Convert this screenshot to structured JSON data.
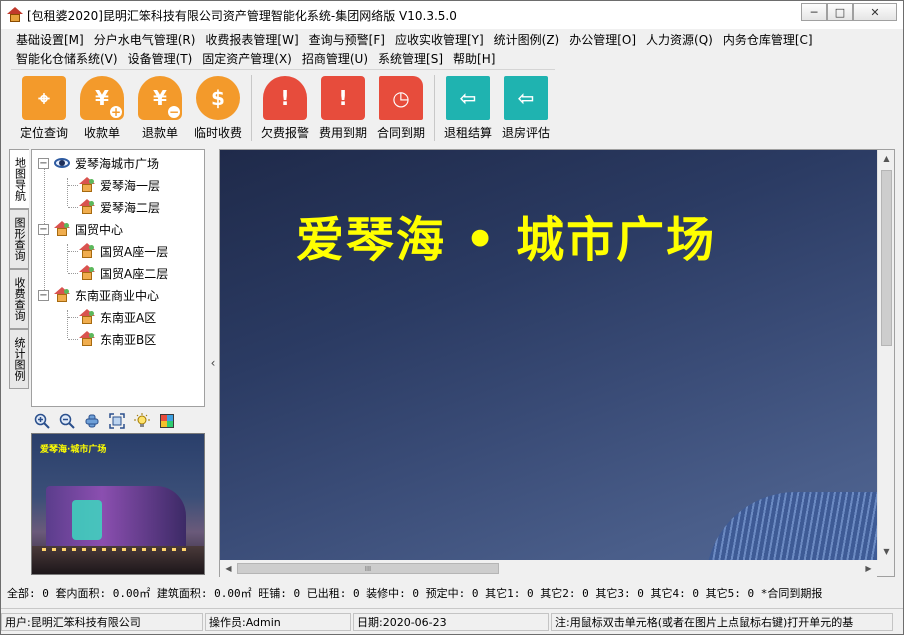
{
  "window": {
    "title": "[包租婆2020]昆明汇笨科技有限公司资产管理智能化系统-集团网络版 V10.3.5.0",
    "min_glyph": "─",
    "max_glyph": "□",
    "close_glyph": "✕"
  },
  "menu": {
    "row1": [
      "基础设置[M]",
      "分户水电气管理(R)",
      "收费报表管理[W]",
      "查询与预警[F]",
      "应收实收管理[Y]",
      "统计图例(Z)",
      "办公管理[O]",
      "人力资源(Q)",
      "内务仓库管理[C]"
    ],
    "row2": [
      "智能化仓储系统(V)",
      "设备管理(T)",
      "固定资产管理(X)",
      "招商管理(U)",
      "系统管理[S]",
      "帮助[H]"
    ]
  },
  "toolbar": {
    "items": [
      {
        "label": "定位查询",
        "icon": "map-pin-icon"
      },
      {
        "label": "收款单",
        "icon": "yen-add-icon"
      },
      {
        "label": "退款单",
        "icon": "yen-minus-icon"
      },
      {
        "label": "临时收费",
        "icon": "clock-dollar-icon"
      },
      {
        "label": "欠费报警",
        "icon": "bell-icon"
      },
      {
        "label": "费用到期",
        "icon": "calendar-alert-icon"
      },
      {
        "label": "合同到期",
        "icon": "document-clock-icon"
      },
      {
        "label": "退租结算",
        "icon": "exit-icon"
      },
      {
        "label": "退房评估",
        "icon": "exit-assess-icon"
      }
    ]
  },
  "vtabs": [
    "地图导航",
    "图形查询",
    "收费查询",
    "统计图例"
  ],
  "tree": {
    "root": "爱琴海城市广场",
    "root_children": [
      "爱琴海一层",
      "爱琴海二层"
    ],
    "node2": "国贸中心",
    "node2_children": [
      "国贸A座一层",
      "国贸A座二层"
    ],
    "node3": "东南亚商业中心",
    "node3_children": [
      "东南亚A区",
      "东南亚B区"
    ]
  },
  "map_tools": [
    "zoom-in-icon",
    "zoom-out-icon",
    "pan-icon",
    "fit-icon",
    "light-icon",
    "layers-icon"
  ],
  "thumbnail": {
    "title": "爱琴海·城市广场"
  },
  "main": {
    "title": "爱琴海 • 城市广场",
    "hscroll_grip": "III"
  },
  "stats": {
    "text": "全部: 0   套内面积: 0.00㎡   建筑面积: 0.00㎡   旺铺: 0   已出租: 0   装修中: 0   预定中: 0   其它1: 0   其它2: 0   其它3: 0   其它4: 0   其它5: 0   *合同到期报"
  },
  "status": {
    "user": "用户:昆明汇笨科技有限公司",
    "operator": "操作员:Admin",
    "date": "日期:2020-06-23",
    "note": "注:用鼠标双击单元格(或者在图片上点鼠标右键)打开单元的基"
  },
  "colors": {
    "accent_orange": "#f39a2b",
    "accent_red": "#e74c3c",
    "accent_teal": "#1fb3b0",
    "title_yellow": "#ffff00"
  }
}
